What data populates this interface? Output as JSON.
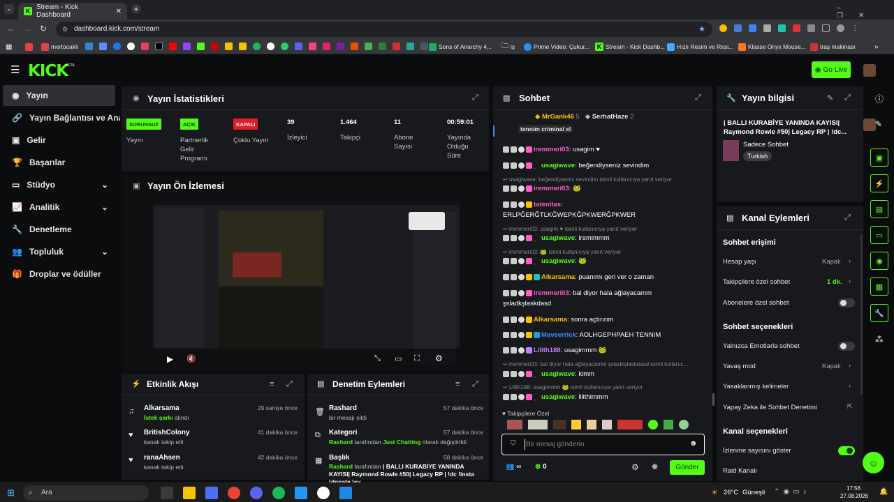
{
  "browser": {
    "tab_title": "Stream - Kick Dashboard",
    "url": "dashboard.kick.com/stream",
    "bookmarks": [
      {
        "label": "",
        "color": "#e84141"
      },
      {
        "label": "mertocakli",
        "color": "#d44"
      },
      {
        "label": "Sons of Anarchy 4...",
        "color": "#2a6"
      },
      {
        "label": "iş",
        "color": "#999"
      },
      {
        "label": "Prime Video: Çukur...",
        "color": "#1a98ff"
      },
      {
        "label": "Stream - Kick Dashb...",
        "color": "#53fc18"
      },
      {
        "label": "Hızlı Resim ve Resi...",
        "color": "#4af"
      },
      {
        "label": "Klasse Onyx Mouse...",
        "color": "#f72"
      },
      {
        "label": "traş makinası",
        "color": "#c33"
      }
    ]
  },
  "header": {
    "logo": "KICK",
    "logo_beta": "BETA",
    "go_live": "Go Live"
  },
  "sidebar": {
    "items": [
      {
        "label": "Yayın",
        "icon": "broadcast-icon",
        "active": true
      },
      {
        "label": "Yayın Bağlantısı ve Anahtarı",
        "icon": "link-icon"
      },
      {
        "label": "Gelir",
        "icon": "wallet-icon"
      },
      {
        "label": "Başarılar",
        "icon": "trophy-icon"
      },
      {
        "label": "Stüdyo",
        "icon": "studio-icon",
        "chevron": true
      },
      {
        "label": "Analitik",
        "icon": "analytics-icon",
        "chevron": true
      },
      {
        "label": "Denetleme",
        "icon": "wrench-icon"
      },
      {
        "label": "Topluluk",
        "icon": "community-icon",
        "chevron": true
      },
      {
        "label": "Droplar ve ödüller",
        "icon": "gift-icon"
      }
    ]
  },
  "stats": {
    "title": "Yayın İstatistikleri",
    "items": [
      {
        "badge": "SORUNSUZ",
        "badge_color": "#53fc18",
        "label": "Yayın"
      },
      {
        "badge": "AÇIK",
        "badge_color": "#53fc18",
        "label": "Partnerlik Gelir Programı"
      },
      {
        "badge": "KAPALI",
        "badge_color": "#e11d2a",
        "label": "Çoklu Yayın"
      },
      {
        "value": "39",
        "label": "İzleyici"
      },
      {
        "value": "1.464",
        "label": "Takipçi"
      },
      {
        "value": "11",
        "label": "Abone Sayısı"
      },
      {
        "value": "00:59:01",
        "label": "Yayında Olduğu Süre"
      }
    ]
  },
  "preview": {
    "title": "Yayın Ön İzlemesi"
  },
  "activity": {
    "title": "Etkinlik Akışı",
    "items": [
      {
        "name": "Alkarsama",
        "highlight": "İstek şarkı",
        "rest": " alındı",
        "time": "29 saniye önce",
        "icon": "song-request-icon"
      },
      {
        "name": "BritishColony",
        "highlight": "",
        "rest": "kanalı takip etti",
        "time": "41 dakika önce",
        "icon": "heart-icon"
      },
      {
        "name": "ranaAhsen",
        "highlight": "",
        "rest": "kanalı takip etti",
        "time": "42 dakika önce",
        "icon": "heart-icon"
      }
    ]
  },
  "moderation": {
    "title": "Denetim Eylemleri",
    "items": [
      {
        "name": "Rashard",
        "line1_a": "",
        "line1_b": "bir mesajı sildi",
        "line1_c": "",
        "line1_d": "",
        "time": "57 dakika önce",
        "icon": "trash-icon"
      },
      {
        "name": "Kategori",
        "line1_a": "Rashard",
        "line1_b": " tarafından ",
        "line1_c": "Just Chatting",
        "line1_d": " olarak değiştirildi",
        "time": "57 dakika önce",
        "icon": "category-icon"
      },
      {
        "name": "Başlık",
        "line1_a": "Rashard",
        "line1_b": " tarafından ",
        "line1_c": "",
        "line1_d": "| BALLI KURABİYE YANINDA KAYISI| Raymond Rowle #50| Legacy RP | !dc !insta !donate !sv",
        "time": "58 dakika önce",
        "icon": "title-icon"
      }
    ]
  },
  "chat": {
    "title": "Sohbet",
    "pinned_users": [
      {
        "name": "MrGank46",
        "count": "5"
      },
      {
        "name": "SerhatHaze",
        "count": "2"
      }
    ],
    "pinned_msg": "tennim criminal xl",
    "messages": [
      {
        "user": "iremmeri03",
        "color": "#ff5cc7",
        "text": ": usagim ♥"
      },
      {
        "user": "usagiwave",
        "color": "#53fc18",
        "text": ": beğendiyseniz sevindim"
      },
      {
        "reply": "usagiwave: beğendiyseniz sevindim isimli kullanıcıya yanıt veriyor"
      },
      {
        "user": "iremmeri03",
        "color": "#ff5cc7",
        "text": ": 🐸"
      },
      {
        "user": "tatenitas",
        "color": "#ff5cc7",
        "text": ":"
      },
      {
        "cont": "ERLPĞERĞTLKĞWEPKĞPKWERĞPKWER"
      },
      {
        "reply": "iremmeri03: usagim ♥ isimli kullanıcıya yanıt veriyor"
      },
      {
        "user": "usagiwave",
        "color": "#53fc18",
        "text": ": iremimmm"
      },
      {
        "reply": "iremmeri03: 🐸 isimli kullanıcıya yanıt veriyor"
      },
      {
        "user": "usagiwave",
        "color": "#53fc18",
        "text": ": 🐸"
      },
      {
        "user": "Alkarsama",
        "color": "#f5c400",
        "text": ": puanımı geri ver o zaman"
      },
      {
        "user": "iremmeri03",
        "color": "#ff5cc7",
        "text": ": bal diyor hala ağlayacamm"
      },
      {
        "cont": "şsladkşlaskdasd"
      },
      {
        "user": "Alkarsama",
        "color": "#f5c400",
        "text": ": sonra açtırırım"
      },
      {
        "user": "Maveerrick",
        "color": "#3b8bff",
        "text": ": AOLHGEPHPAEH TENNIM"
      },
      {
        "user": "Lilith188",
        "color": "#c77dff",
        "text": ": usagimmm 🐸"
      },
      {
        "reply": "iremmeri03: bal diyor hala ağlayacamm şsladkşlaskdasd isimli kullanıc..."
      },
      {
        "user": "usagiwave",
        "color": "#53fc18",
        "text": ": kimm"
      },
      {
        "reply": "Lilith188: usagimmm 🐸 isimli kullanıcıya yanıt veriyor"
      },
      {
        "user": "usagiwave",
        "color": "#53fc18",
        "text": ": lilithimmm"
      }
    ],
    "followers_only": "Takipçilere Özel",
    "input_placeholder": "Bir mesaj gönderin",
    "infinity": "∞",
    "points": "0",
    "send": "Gönder"
  },
  "stream_info": {
    "title": "Yayın bilgisi",
    "stream_title": "| BALLI KURABİYE YANINDA KAYISI| Raymond Rowle #50| Legacy RP | !dc...",
    "category": "Sadece Sohbet",
    "tag": "Turkish"
  },
  "channel_actions": {
    "title": "Kanal Eylemleri",
    "sec_access": "Sohbet erişimi",
    "account_age": "Hesap yaşı",
    "account_age_val": "Kapalı",
    "followers_chat": "Takipçilere özel sohbet",
    "followers_chat_val": "1 dk.",
    "subs_chat": "Abonelere özel sohbet",
    "sec_options": "Sohbet seçenekleri",
    "emotes_only": "Yalnızca Emotlarla sohbet",
    "slow_mode": "Yavaş mod",
    "slow_mode_val": "Kapalı",
    "banned_words": "Yasaklanmış kelimeler",
    "ai_mod": "Yapay Zeka ile Sohbet Denetimi",
    "sec_channel": "Kanal seçenekleri",
    "show_viewers": "İzlenme sayısını göster",
    "raid": "Raid Kanalı"
  },
  "taskbar": {
    "search": "Ara",
    "weather": "26°C",
    "weather_desc": "Güneşli",
    "time": "17:56",
    "date": "27.08.2026"
  }
}
